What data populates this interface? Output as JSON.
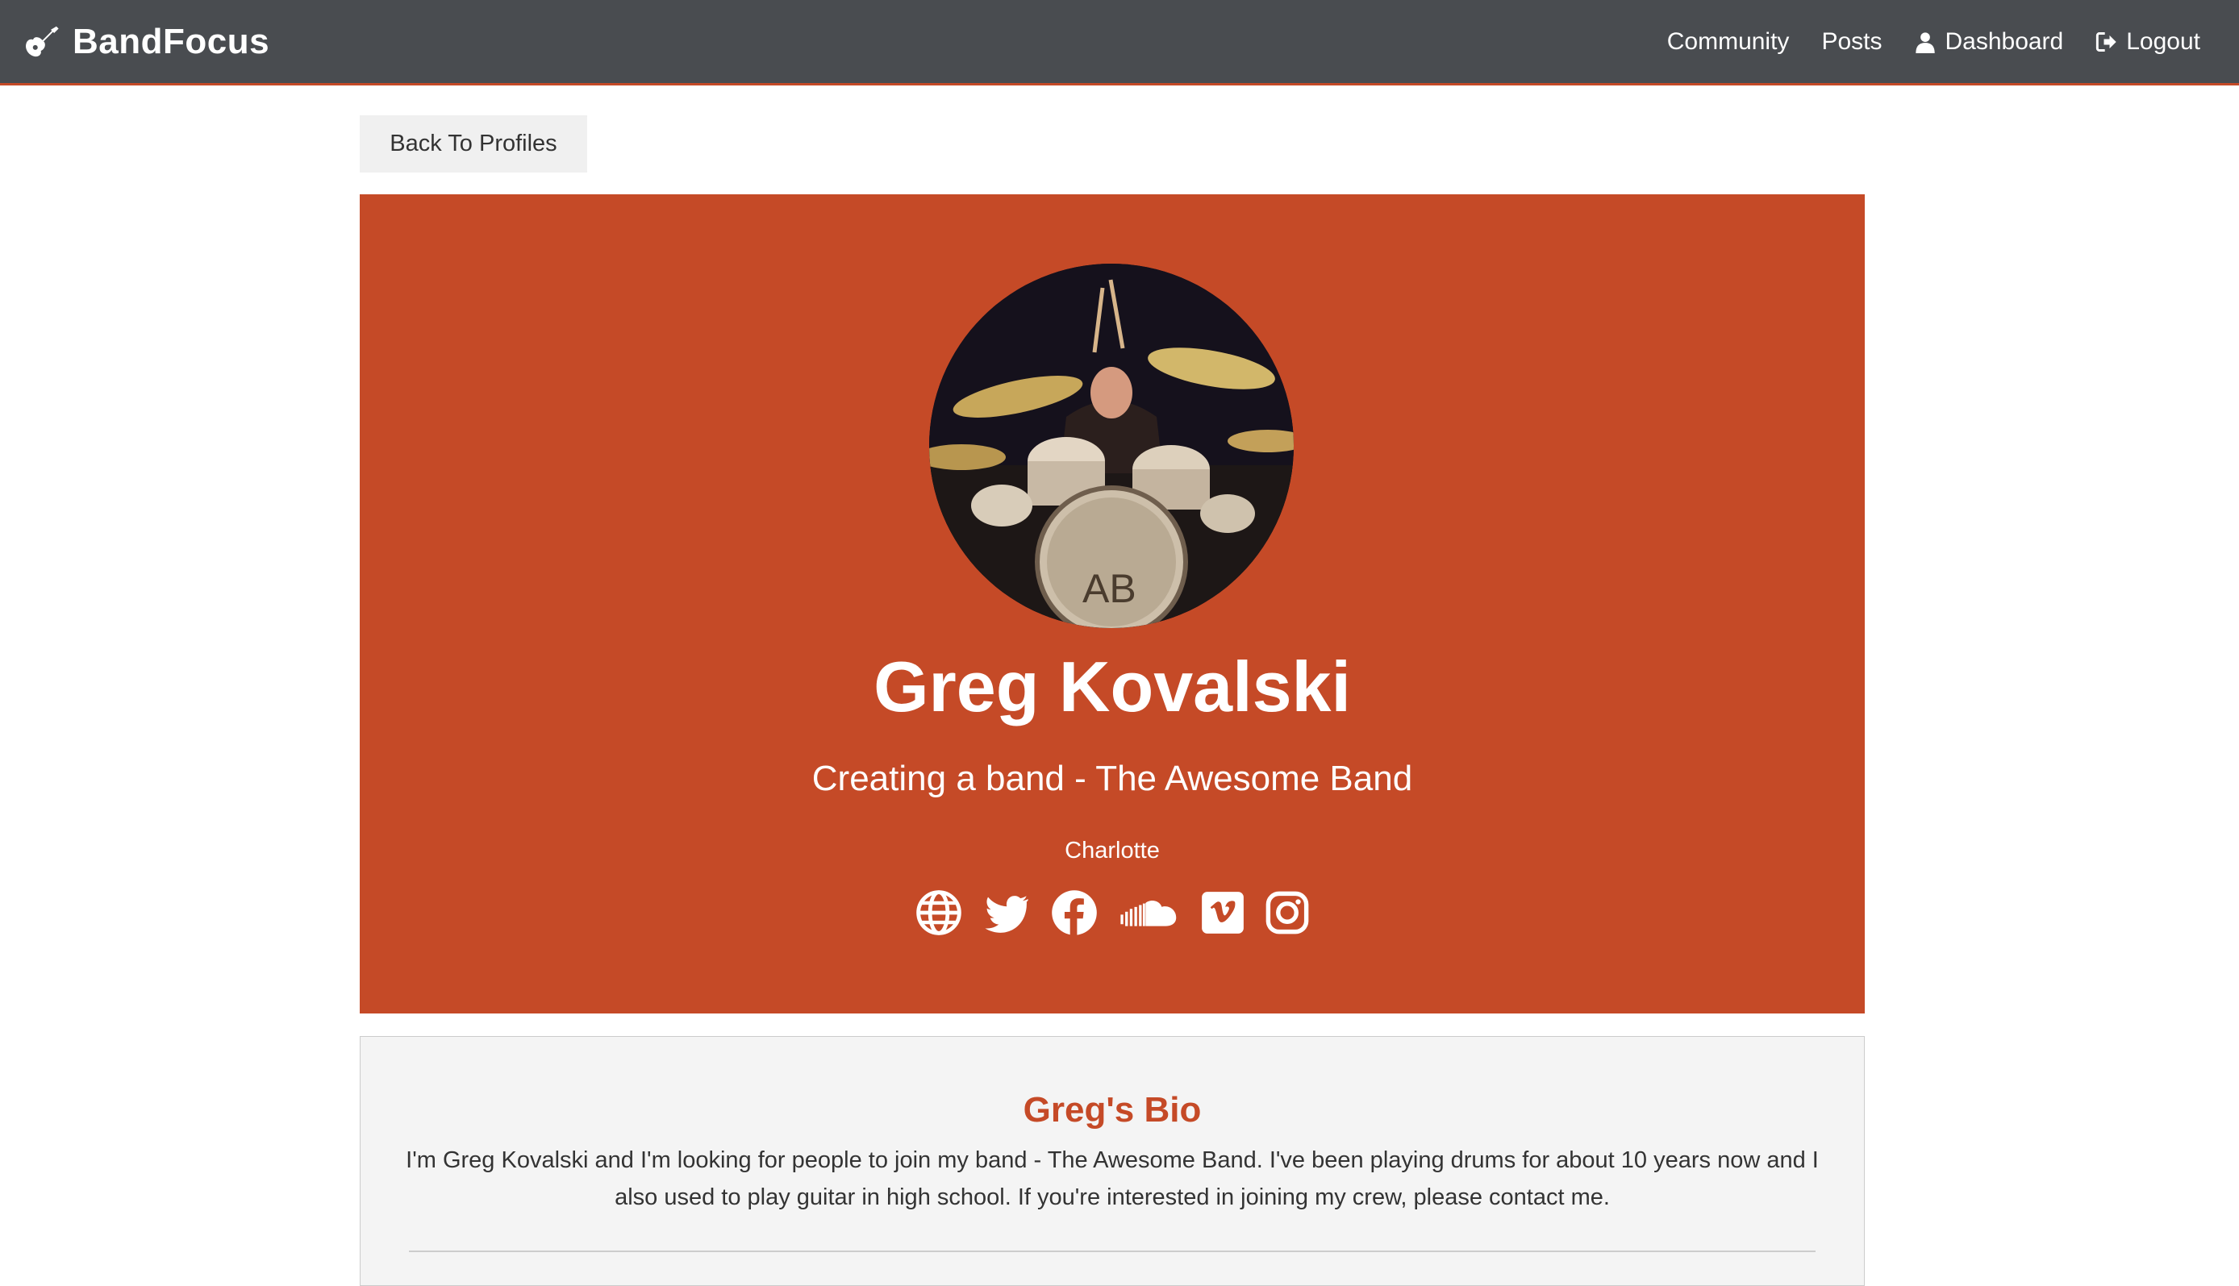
{
  "nav": {
    "brand": "BandFocus",
    "links": [
      {
        "label": "Community",
        "icon": ""
      },
      {
        "label": "Posts",
        "icon": ""
      },
      {
        "label": "Dashboard",
        "icon": "user-icon"
      },
      {
        "label": "Logout",
        "icon": "logout-icon"
      }
    ]
  },
  "back_button": "Back To Profiles",
  "profile": {
    "name": "Greg Kovalski",
    "status": "Creating a band - The Awesome Band",
    "location": "Charlotte",
    "avatar_alt": "drummer-photo",
    "social_icons": [
      "globe-icon",
      "twitter-icon",
      "facebook-icon",
      "soundcloud-icon",
      "vimeo-icon",
      "instagram-icon"
    ]
  },
  "bio": {
    "title": "Greg's Bio",
    "text": "I'm Greg Kovalski and I'm looking for people to join my band - The Awesome Band. I've been playing drums for about 10 years now and I also used to play guitar in high school. If you're interested in joining my crew, please contact me."
  },
  "colors": {
    "navbar": "#494c50",
    "accent": "#c54a27",
    "bio_background": "#f4f4f4",
    "button_background": "#f0f0f0"
  }
}
